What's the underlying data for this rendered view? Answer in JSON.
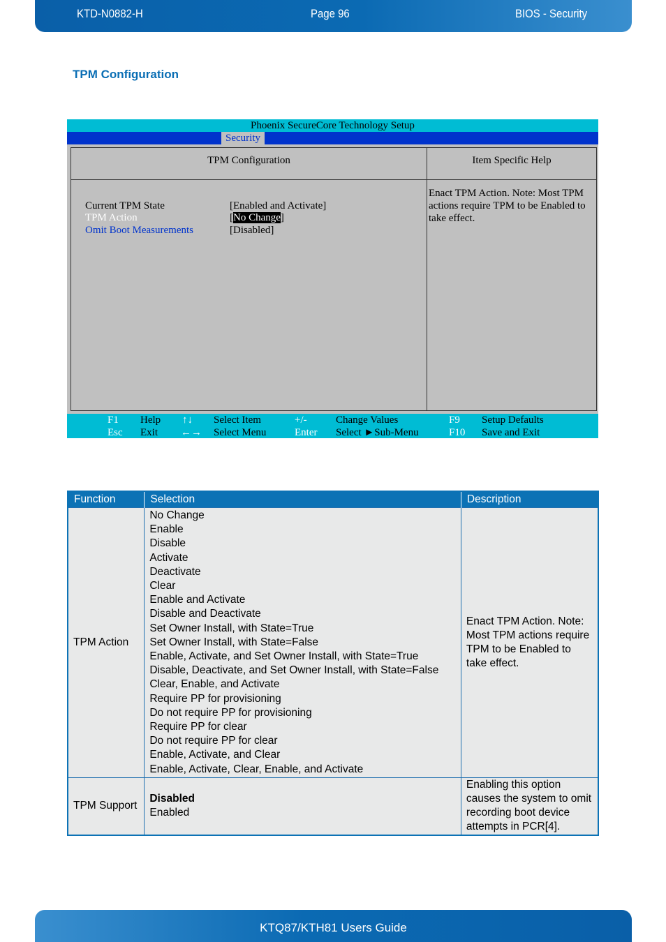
{
  "header": {
    "doc_id": "KTD-N0882-H",
    "page": "Page 96",
    "section": "BIOS  - Security"
  },
  "section_title": "TPM Configuration",
  "bios": {
    "title": "Phoenix SecureCore Technology Setup",
    "active_tab": "Security",
    "left_heading": "TPM Configuration",
    "right_heading": "Item Specific Help",
    "items": [
      {
        "label": "Current TPM State",
        "value": "[Enabled and Activate]",
        "state": "static"
      },
      {
        "label": "TPM Action",
        "value_open": "[",
        "value": "No Change",
        "value_close": "]",
        "state": "selected"
      },
      {
        "label": "Omit Boot Measurements",
        "value": "[Disabled]",
        "state": "selectable"
      }
    ],
    "help_text": "Enact TPM Action. Note: Most TPM actions require TPM to be Enabled to take effect.",
    "keys": [
      {
        "key": "F1",
        "action": "Help"
      },
      {
        "key": "Esc",
        "action": "Exit"
      },
      {
        "key": "↑↓",
        "action": "Select Item"
      },
      {
        "key": "←→",
        "action": "Select Menu"
      },
      {
        "key": "+/-",
        "action": "Change Values"
      },
      {
        "key": "Enter",
        "action": "Select ►Sub-Menu"
      },
      {
        "key": "F9",
        "action": "Setup Defaults"
      },
      {
        "key": "F10",
        "action": "Save and Exit"
      }
    ],
    "colors": {
      "title_bar": "#00bcd4",
      "menu_bar": "#0033cc",
      "body": "#c0c0c0"
    }
  },
  "table": {
    "headers": [
      "Function",
      "Selection",
      "Description"
    ],
    "rows": [
      {
        "function": "TPM Action",
        "selections": [
          "No Change",
          "Enable",
          "Disable",
          "Activate",
          "Deactivate",
          "Clear",
          "Enable and Activate",
          "Disable and Deactivate",
          "Set Owner Install, with State=True",
          "Set Owner Install, with State=False",
          "Enable, Activate, and  Set Owner Install, with State=True",
          "Disable, Deactivate, and  Set Owner Install, with State=False",
          "Clear, Enable, and Activate",
          "Require PP for provisioning",
          "Do not require PP for provisioning",
          "Require PP for clear",
          "Do not require PP for clear",
          "Enable, Activate, and Clear",
          "Enable, Activate, Clear, Enable,  and Activate"
        ],
        "description": "Enact TPM Action. Note: Most TPM actions require TPM to be Enabled to take effect."
      },
      {
        "function": "TPM Support",
        "selections": [
          "Disabled",
          "Enabled"
        ],
        "default": "Disabled",
        "description": "Enabling this option causes the system to omit recording boot device attempts in PCR[4]."
      }
    ]
  },
  "footer": {
    "title": "KTQ87/KTH81 Users Guide"
  }
}
